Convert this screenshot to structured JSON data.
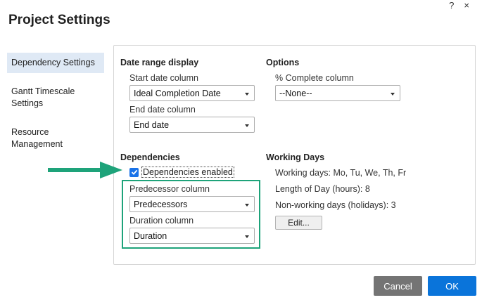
{
  "window": {
    "title": "Project Settings",
    "help_glyph": "?",
    "close_glyph": "×"
  },
  "sidebar": {
    "items": [
      {
        "label": "Dependency Settings",
        "active": true
      },
      {
        "label": "Gantt Timescale Settings",
        "active": false
      },
      {
        "label": "Resource Management",
        "active": false
      }
    ]
  },
  "date_range": {
    "heading": "Date range display",
    "start_label": "Start date column",
    "start_value": "Ideal Completion Date",
    "end_label": "End date column",
    "end_value": "End date"
  },
  "options": {
    "heading": "Options",
    "complete_label": "% Complete column",
    "complete_value": "--None--"
  },
  "dependencies": {
    "heading": "Dependencies",
    "enabled_label": "Dependencies enabled",
    "enabled": true,
    "predecessor_label": "Predecessor column",
    "predecessor_value": "Predecessors",
    "duration_label": "Duration column",
    "duration_value": "Duration"
  },
  "working_days": {
    "heading": "Working Days",
    "days_text": "Working days: Mo, Tu, We, Th, Fr",
    "length_text": "Length of Day (hours): 8",
    "nonworking_text": "Non-working days (holidays): 3",
    "edit_label": "Edit..."
  },
  "footer": {
    "cancel_label": "Cancel",
    "ok_label": "OK"
  },
  "colors": {
    "ok_button": "#0a74da",
    "cancel_button": "#747474",
    "highlight_green": "#1ea37a",
    "sidebar_active": "#dfe9f5"
  }
}
